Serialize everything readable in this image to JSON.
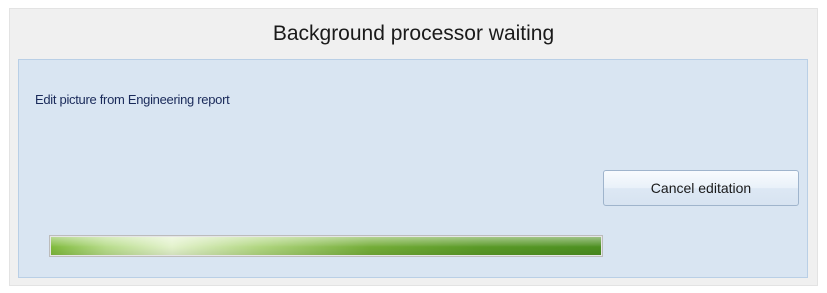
{
  "window": {
    "title": "Background processor waiting"
  },
  "dialog": {
    "message": "Edit picture from Engineering report",
    "progress": {
      "percent": 100,
      "fill_color_start": "#7fba3c",
      "fill_color_end": "#4c8f20"
    },
    "cancel_label": "Cancel editation"
  },
  "colors": {
    "client_background": "#d9e5f2",
    "window_background": "#f0f0f0"
  }
}
